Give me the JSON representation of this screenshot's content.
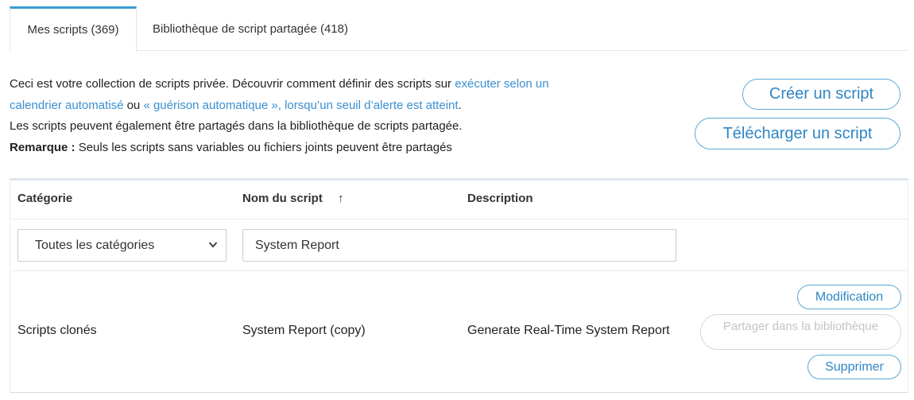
{
  "tabs": [
    {
      "label": "Mes scripts (369)",
      "active": true
    },
    {
      "label": "Bibliothèque de script partagée (418)",
      "active": false
    }
  ],
  "intro": {
    "line1_text": "Ceci est votre collection de scripts privée. Découvrir comment définir des scripts sur ",
    "link_schedule": "exécuter selon un calendrier automatisé",
    "or_text": " ou ",
    "link_autoheal": "« guérison automatique », lorsqu’un seuil d’alerte est atteint",
    "period": ".",
    "line3_text": "Les scripts peuvent également être partagés dans la bibliothèque de scripts partagée.",
    "note_label": "Remarque :",
    "note_text": " Seuls les scripts sans variables ou fichiers joints peuvent être partagés"
  },
  "actions": {
    "create_label": "Créer un script",
    "upload_label": "Télécharger un script"
  },
  "table": {
    "columns": [
      "Catégorie",
      "Nom du script",
      "Description"
    ],
    "sort_indicator": "↑",
    "filters": {
      "category_selected": "Toutes les catégories",
      "script_name_value": "System Report"
    },
    "rows": [
      {
        "category": "Scripts clonés",
        "name": "System Report (copy)",
        "description": "Generate Real-Time System Report",
        "edit_label": "Modification",
        "share_label": "Partager dans la bibliothèque",
        "delete_label": "Supprimer"
      }
    ]
  },
  "colors": {
    "accent": "#3a9bd5",
    "link": "#3a8fd0",
    "disabled": "#c4c4c4"
  }
}
